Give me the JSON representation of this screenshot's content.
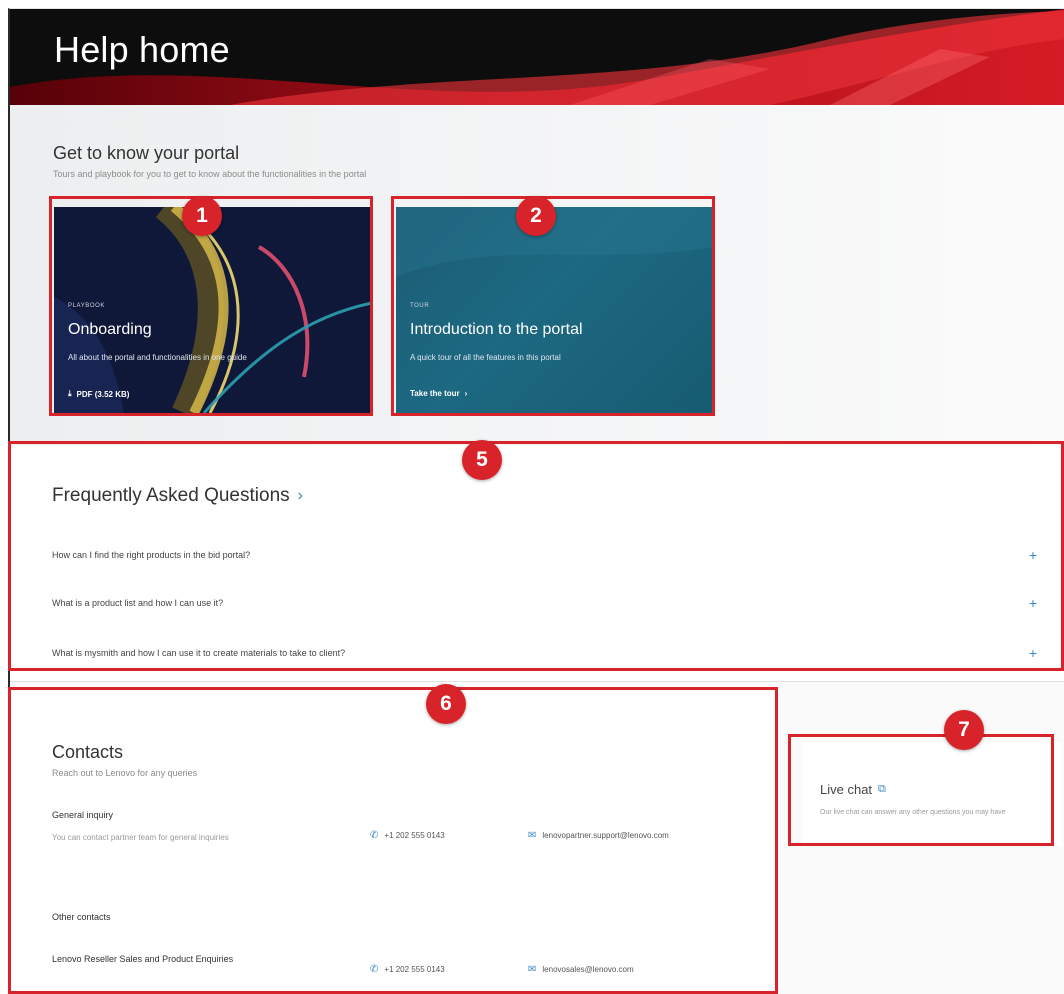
{
  "banner": {
    "title": "Help home"
  },
  "know": {
    "title": "Get to know your portal",
    "subtitle": "Tours and playbook for you to get to know about the functionalities in the portal",
    "cards": [
      {
        "eyebrow": "PLAYBOOK",
        "title": "Onboarding",
        "description": "All about the portal and functionalities in one guide",
        "link": "PDF (3.52 KB)",
        "link_icon": "download-icon"
      },
      {
        "eyebrow": "TOUR",
        "title": "Introduction to the portal",
        "description": "A quick tour of all the features in this portal",
        "link": "Take the tour",
        "link_icon": "chevron-right-icon"
      }
    ]
  },
  "faq": {
    "title": "Frequently Asked Questions",
    "items": [
      "How can I find the right products in the bid portal?",
      "What is a product list and how I can use it?",
      "What is mysmith and how I can use it to create materials to take to client?"
    ]
  },
  "contacts": {
    "title": "Contacts",
    "subtitle": "Reach out to Lenovo for any queries",
    "general": {
      "label": "General inquiry",
      "note": "You can contact partner team for general inquiries",
      "phone": "+1 202 555 0143",
      "email": "lenovopartner.support@lenovo.com"
    },
    "other_label": "Other contacts",
    "reseller": {
      "label": "Lenovo Reseller Sales and Product Enquiries",
      "phone": "+1 202 555 0143",
      "email": "lenovosales@lenovo.com"
    }
  },
  "chat": {
    "title": "Live chat",
    "description": "Our live chat can answer any other questions you may have"
  },
  "annotations": [
    "1",
    "2",
    "5",
    "6",
    "7"
  ],
  "colors": {
    "annotation_red": "#d8232a",
    "link_blue": "#3a86c8",
    "banner_red": "#c0111c"
  }
}
